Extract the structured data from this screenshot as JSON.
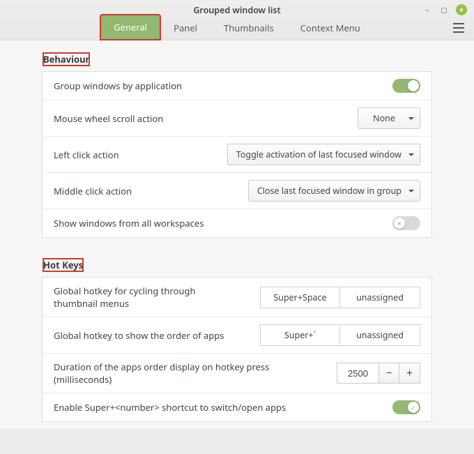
{
  "window": {
    "title": "Grouped window list"
  },
  "tabs": {
    "general": "General",
    "panel": "Panel",
    "thumbnails": "Thumbnails",
    "context_menu": "Context Menu"
  },
  "sections": {
    "behaviour": {
      "title": "Behaviour",
      "rows": {
        "group_windows": {
          "label": "Group windows by application",
          "value": true
        },
        "mouse_wheel": {
          "label": "Mouse wheel scroll action",
          "value": "None"
        },
        "left_click": {
          "label": "Left click action",
          "value": "Toggle activation of last focused window"
        },
        "middle_click": {
          "label": "Middle click action",
          "value": "Close last focused window in group"
        },
        "show_all_ws": {
          "label": "Show windows from all workspaces",
          "value": false
        }
      }
    },
    "hotkeys": {
      "title": "Hot Keys",
      "rows": {
        "cycle_thumb": {
          "label": "Global hotkey for cycling through thumbnail menus",
          "primary": "Super+Space",
          "secondary": "unassigned"
        },
        "show_order": {
          "label": "Global hotkey to show the order of apps",
          "primary": "Super+`",
          "secondary": "unassigned"
        },
        "duration": {
          "label": "Duration of the apps order display on hotkey press (milliseconds)",
          "value": "2500"
        },
        "super_num": {
          "label": "Enable Super+<number> shortcut to switch/open apps",
          "value": true
        }
      }
    }
  }
}
